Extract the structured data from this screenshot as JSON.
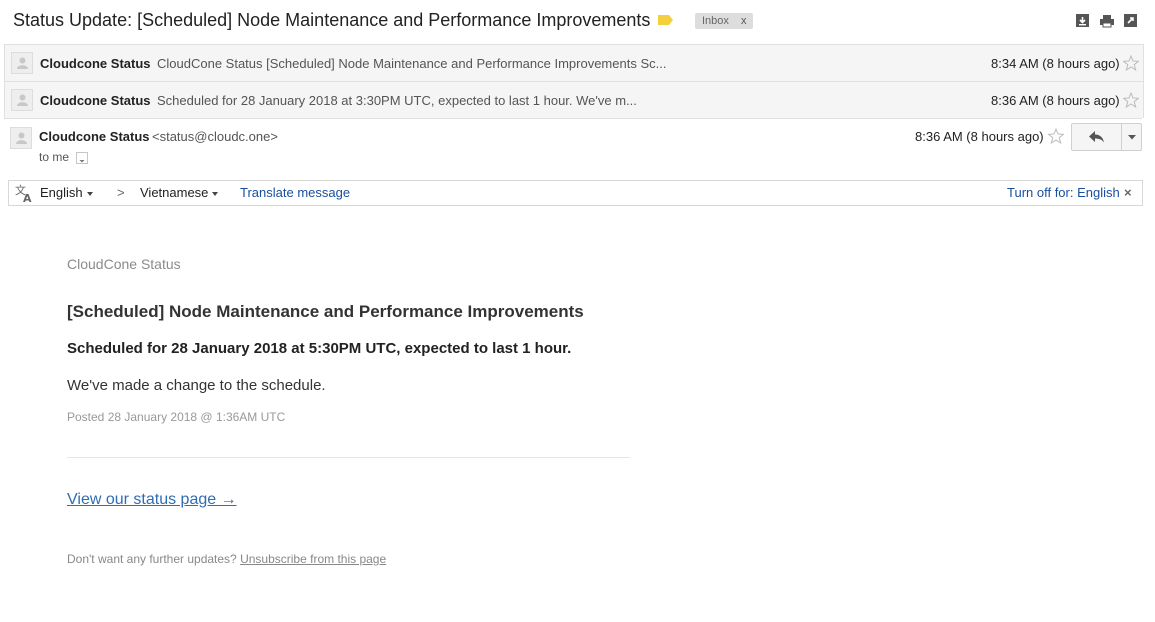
{
  "header": {
    "subject": "Status Update: [Scheduled] Node Maintenance and Performance Improvements",
    "label_chip": "Inbox",
    "label_remove": "x",
    "colors": {
      "label_tag": "#f4d03f",
      "chip_bg": "#dddddd"
    }
  },
  "messages": [
    {
      "sender": "Cloudcone Status",
      "snippet": "CloudCone Status [Scheduled] Node Maintenance and Performance Improvements Sc...",
      "time": "8:34 AM (8 hours ago)"
    },
    {
      "sender": "Cloudcone Status",
      "snippet": "Scheduled for 28 January 2018 at 3:30PM UTC, expected to last 1 hour. We've m...",
      "time": "8:36 AM (8 hours ago)"
    }
  ],
  "open_message": {
    "sender": "Cloudcone Status",
    "email": "<status@cloudc.one>",
    "to": "to me",
    "time": "8:36 AM (8 hours ago)"
  },
  "translate_bar": {
    "source_lang": "English",
    "arrow": ">",
    "target_lang": "Vietnamese",
    "translate_link": "Translate message",
    "turn_off": "Turn off for: English",
    "close": "×"
  },
  "body": {
    "org": "CloudCone Status",
    "title": "[Scheduled] Node Maintenance and Performance Improvements",
    "schedule": "Scheduled for 28 January 2018 at 5:30PM UTC, expected to last 1 hour.",
    "change": "We've made a change to the schedule.",
    "posted": "Posted 28 January 2018 @ 1:36AM UTC",
    "status_link": "View our status page →",
    "footer_prefix": "Don't want any further updates?",
    "unsubscribe": "Unsubscribe from this page"
  },
  "icons": [
    "download-icon",
    "print-icon",
    "new-window-icon",
    "star-icon",
    "reply-icon",
    "translate-icon"
  ]
}
